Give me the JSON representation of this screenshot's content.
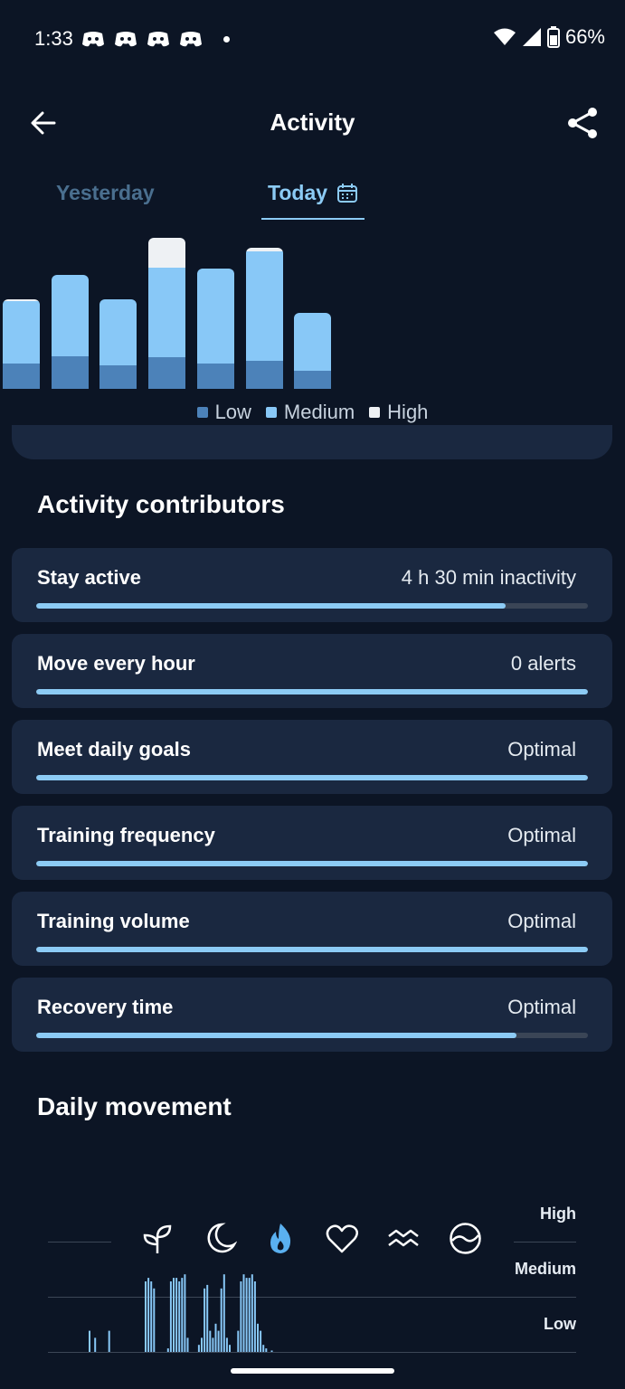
{
  "status_bar": {
    "time": "1:33",
    "battery": "66%",
    "notification_icons": [
      "discord-icon",
      "discord-icon",
      "discord-icon",
      "discord-icon"
    ]
  },
  "header": {
    "title": "Activity",
    "back_icon": "arrow-left-icon",
    "share_icon": "share-icon"
  },
  "tabs": {
    "yesterday": "Yesterday",
    "today": "Today",
    "selected": "Today",
    "today_icon": "calendar-icon"
  },
  "weekly_chart": {
    "bars": [
      {
        "low": 28,
        "medium": 69,
        "high": 2
      },
      {
        "low": 36,
        "medium": 90,
        "high": 0
      },
      {
        "low": 26,
        "medium": 73,
        "high": 0
      },
      {
        "low": 35,
        "medium": 99,
        "high": 33
      },
      {
        "low": 28,
        "medium": 105,
        "high": 0
      },
      {
        "low": 31,
        "medium": 121,
        "high": 4
      },
      {
        "low": 20,
        "medium": 64,
        "high": 0
      }
    ],
    "colors": {
      "low": "#4c82b9",
      "medium": "#88c8f7",
      "high": "#eef1f4"
    }
  },
  "legend": {
    "low": "Low",
    "medium": "Medium",
    "high": "High"
  },
  "contributors": {
    "title": "Activity contributors",
    "items": [
      {
        "label": "Stay active",
        "value": "4 h 30 min inactivity",
        "progress": 0.85
      },
      {
        "label": "Move every hour",
        "value": "0 alerts",
        "progress": 1.0
      },
      {
        "label": "Meet daily goals",
        "value": "Optimal",
        "progress": 1.0
      },
      {
        "label": "Training frequency",
        "value": "Optimal",
        "progress": 1.0
      },
      {
        "label": "Training volume",
        "value": "Optimal",
        "progress": 1.0
      },
      {
        "label": "Recovery time",
        "value": "Optimal",
        "progress": 0.87
      }
    ]
  },
  "daily_movement": {
    "title": "Daily movement",
    "levels": {
      "high": "High",
      "medium": "Medium",
      "low": "Low"
    },
    "icons": [
      "sprout-icon",
      "moon-icon",
      "flame-icon",
      "heart-icon",
      "waves-icon",
      "stress-icon"
    ],
    "active_icon": "flame-icon",
    "bar_levels": [
      0.3,
      0,
      0.2,
      0,
      0,
      0,
      0,
      0.3,
      0,
      0,
      0,
      0,
      0,
      0,
      0,
      0,
      0,
      0,
      0,
      0,
      1.0,
      1.05,
      1.0,
      0.9,
      0,
      0,
      0,
      0,
      0.05,
      1.0,
      1.05,
      1.05,
      1.0,
      1.05,
      1.1,
      0.2,
      0,
      0,
      0,
      0.1,
      0.2,
      0.9,
      0.95,
      0.3,
      0.2,
      0.4,
      0.3,
      0.9,
      1.1,
      0.2,
      0.1,
      0,
      0,
      0.3,
      1.0,
      1.1,
      1.05,
      1.05,
      1.1,
      1.0,
      0.4,
      0.3,
      0.1,
      0.05,
      0,
      0.02
    ]
  }
}
